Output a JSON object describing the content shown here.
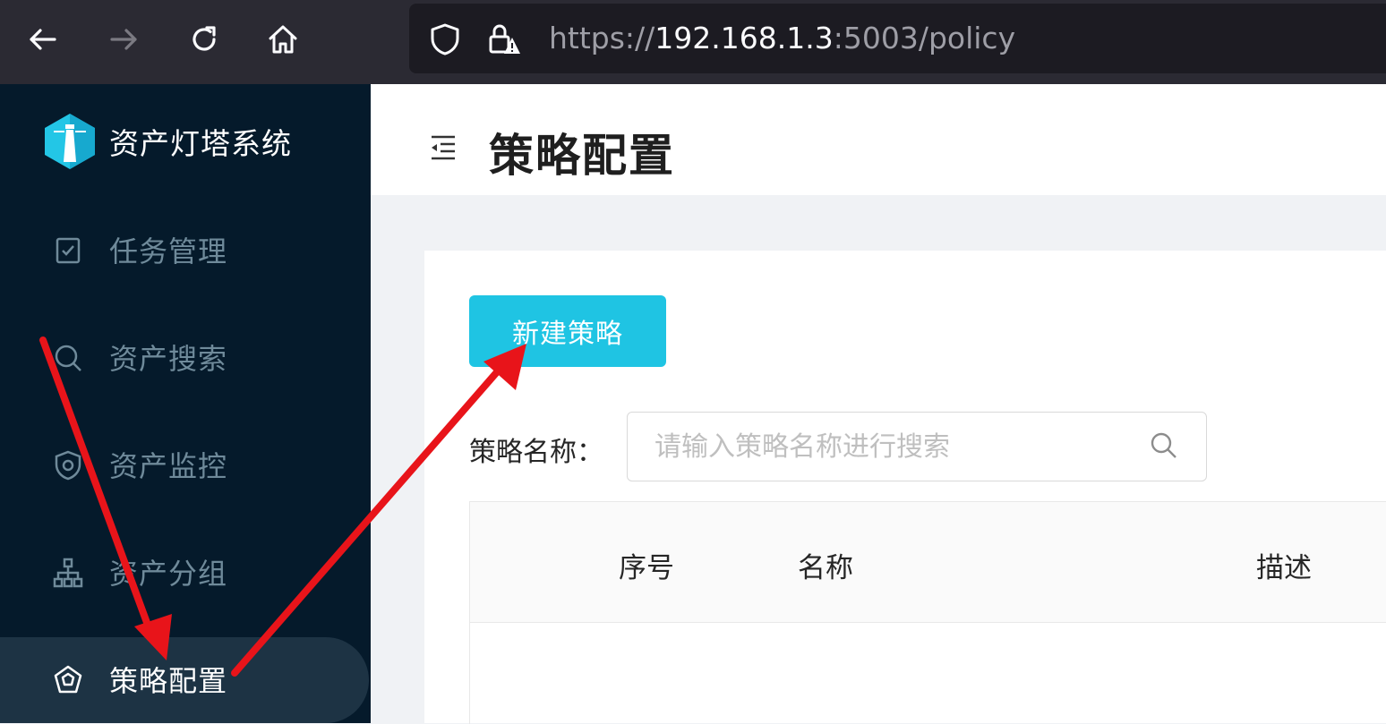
{
  "browser": {
    "url_scheme": "https://",
    "url_host": "192.168.1.3",
    "url_rest": ":5003/policy"
  },
  "sidebar": {
    "brand": "资产灯塔系统",
    "items": [
      {
        "label": "任务管理",
        "icon": "task-icon"
      },
      {
        "label": "资产搜索",
        "icon": "search-icon"
      },
      {
        "label": "资产监控",
        "icon": "monitor-shield-icon"
      },
      {
        "label": "资产分组",
        "icon": "group-tree-icon"
      },
      {
        "label": "策略配置",
        "icon": "policy-icon",
        "active": true
      }
    ]
  },
  "header": {
    "title": "策略配置"
  },
  "main": {
    "new_button_label": "新建策略",
    "search_label": "策略名称：",
    "search_placeholder": "请输入策略名称进行搜索",
    "table_headers": [
      "序号",
      "名称",
      "描述"
    ]
  },
  "colors": {
    "sidebar_bg": "#051a2b",
    "accent": "#1fc4e3",
    "annotation_arrow": "#e8141a"
  }
}
